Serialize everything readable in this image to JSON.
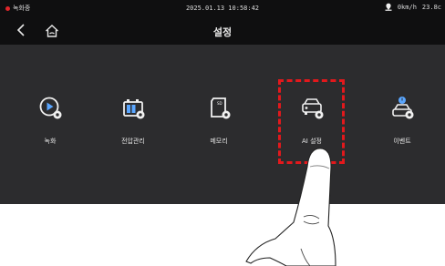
{
  "status": {
    "rec_label": "녹화중",
    "datetime": "2025.01.13 10:58:42",
    "speed": "0km/h",
    "temp": "23.8c"
  },
  "titlebar": {
    "title": "설정"
  },
  "menu": {
    "items": [
      {
        "label": "녹화"
      },
      {
        "label": "전압관리"
      },
      {
        "label": "메모리"
      },
      {
        "label": "AI 설정"
      },
      {
        "label": "이벤트"
      }
    ]
  },
  "colors": {
    "highlight": "#e3181c",
    "screen_bg": "#2c2c2e",
    "bar_bg": "#0f0f10"
  },
  "icons": [
    "rec-settings-icon",
    "battery-settings-icon",
    "memory-card-settings-icon",
    "ai-car-settings-icon",
    "event-settings-icon"
  ]
}
